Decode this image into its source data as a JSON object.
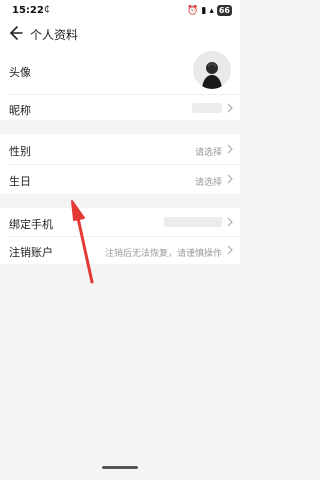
{
  "status_bar": {
    "time": "15:22",
    "nfc_symbol": "₵",
    "battery": "66"
  },
  "header": {
    "title": "个人资料"
  },
  "profile_rows": [
    {
      "label": "头像"
    },
    {
      "label": "昵称"
    }
  ],
  "info_rows": [
    {
      "label": "性别",
      "value": "请选择"
    },
    {
      "label": "生日",
      "value": "请选择"
    }
  ],
  "account_rows": [
    {
      "label": "绑定手机"
    },
    {
      "label": "注销账户",
      "value": "注销后无法恢复，请谨慎操作"
    }
  ],
  "colors": {
    "background": "#f4f4f4",
    "card": "#ffffff",
    "annotation_arrow": "#e53935"
  },
  "icons": [
    "back-arrow-icon",
    "chevron-right-icon",
    "avatar-icon",
    "battery-icon",
    "signal-icon",
    "wifi-icon",
    "alarm-icon"
  ]
}
